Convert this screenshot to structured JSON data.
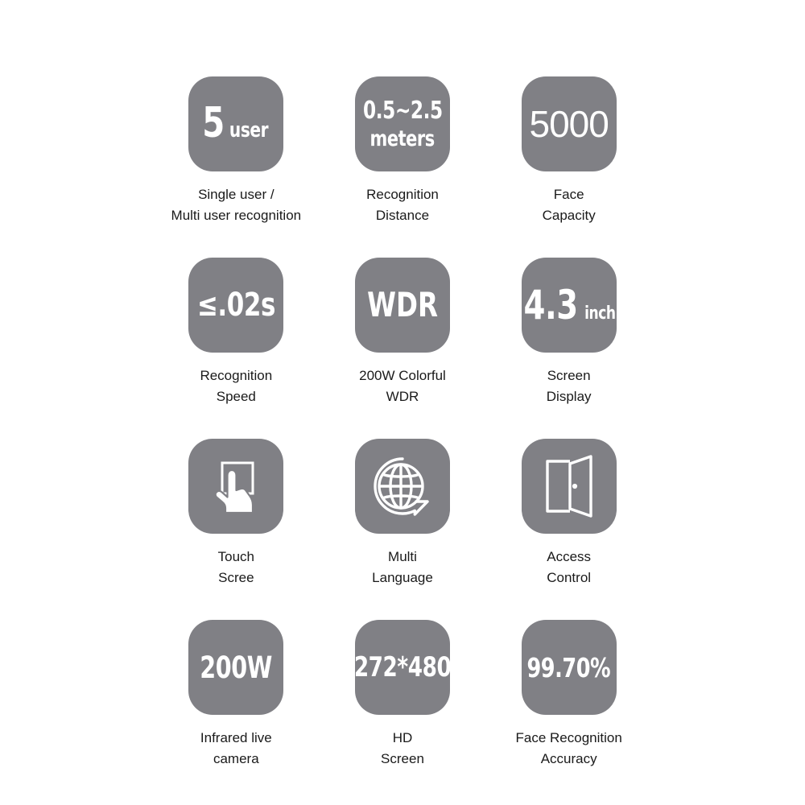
{
  "page": {
    "background_color": "#ffffff",
    "tile_color": "#808085",
    "tile_text_color": "#ffffff",
    "caption_color": "#1a1a1a"
  },
  "features": [
    {
      "id": "single-multi-user-recognition",
      "tile_kind": "text",
      "tile_text_primary": "5",
      "tile_text_secondary": "user",
      "caption_line1": "Single user /",
      "caption_line2": "Multi user recognition"
    },
    {
      "id": "recognition-distance",
      "tile_kind": "text",
      "tile_text_primary": "0.5∼2.5",
      "tile_text_secondary": "meters",
      "caption_line1": "Recognition",
      "caption_line2": "Distance"
    },
    {
      "id": "face-capacity",
      "tile_kind": "text",
      "tile_text_primary": "5000",
      "tile_text_secondary": "",
      "caption_line1": "Face",
      "caption_line2": "Capacity"
    },
    {
      "id": "recognition-speed",
      "tile_kind": "text",
      "tile_text_primary": "≤.02s",
      "tile_text_secondary": "",
      "caption_line1": "Recognition",
      "caption_line2": "Speed"
    },
    {
      "id": "colorful-wdr",
      "tile_kind": "text",
      "tile_text_primary": "WDR",
      "tile_text_secondary": "",
      "caption_line1": "200W Colorful",
      "caption_line2": "WDR"
    },
    {
      "id": "screen-display",
      "tile_kind": "text",
      "tile_text_primary": "4.3",
      "tile_text_secondary": "inch",
      "caption_line1": "Screen",
      "caption_line2": "Display"
    },
    {
      "id": "touch-screen",
      "tile_kind": "icon",
      "icon_name": "touch-hand-icon",
      "caption_line1": "Touch",
      "caption_line2": "Scree"
    },
    {
      "id": "multi-language",
      "tile_kind": "icon",
      "icon_name": "globe-speech-bubble-icon",
      "caption_line1": "Multi",
      "caption_line2": "Language"
    },
    {
      "id": "access-control",
      "tile_kind": "icon",
      "icon_name": "open-door-icon",
      "caption_line1": "Access",
      "caption_line2": "Control"
    },
    {
      "id": "infrared-live-camera",
      "tile_kind": "text",
      "tile_text_primary": "200W",
      "tile_text_secondary": "",
      "caption_line1": "Infrared live",
      "caption_line2": "camera"
    },
    {
      "id": "hd-screen",
      "tile_kind": "text",
      "tile_text_primary": "272*480",
      "tile_text_secondary": "",
      "caption_line1": "HD",
      "caption_line2": "Screen"
    },
    {
      "id": "face-recognition-accuracy",
      "tile_kind": "text",
      "tile_text_primary": "99.70%",
      "tile_text_secondary": "",
      "caption_line1": "Face Recognition",
      "caption_line2": "Accuracy"
    }
  ]
}
